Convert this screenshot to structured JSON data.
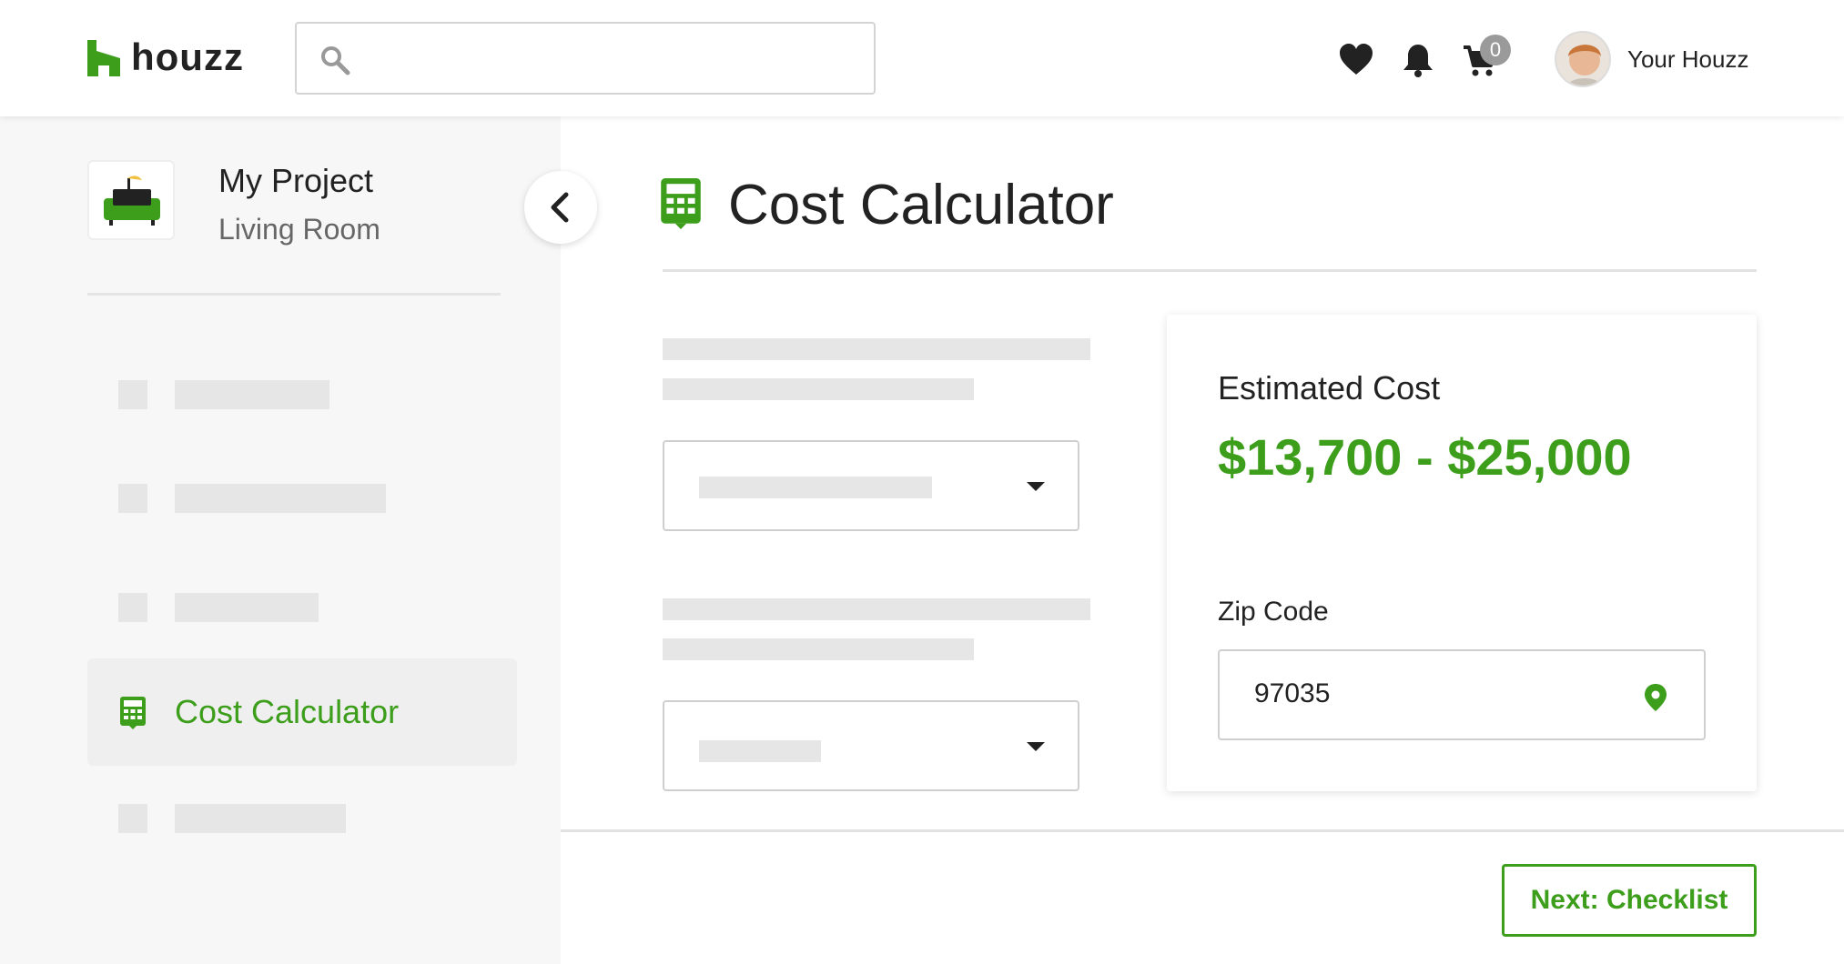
{
  "colors": {
    "brand": "#3d9e1b",
    "text": "#222222",
    "muted": "#666666",
    "placeholder": "#e6e6e6"
  },
  "header": {
    "logo_text": "houzz",
    "search": {
      "placeholder": "",
      "value": ""
    },
    "icons": [
      "heart-icon",
      "bell-icon",
      "cart-icon"
    ],
    "cart_count": "0",
    "user_label": "Your Houzz"
  },
  "sidebar": {
    "project_title": "My Project",
    "project_subtitle": "Living Room",
    "active_item": {
      "label": "Cost Calculator",
      "icon": "calculator-icon"
    }
  },
  "main": {
    "title": "Cost Calculator",
    "title_icon": "calculator-icon",
    "card": {
      "estimate_label": "Estimated Cost",
      "estimate_value": "$13,700 - $25,000",
      "zip_label": "Zip Code",
      "zip_value": "97035"
    },
    "next_button": "Next: Checklist"
  }
}
